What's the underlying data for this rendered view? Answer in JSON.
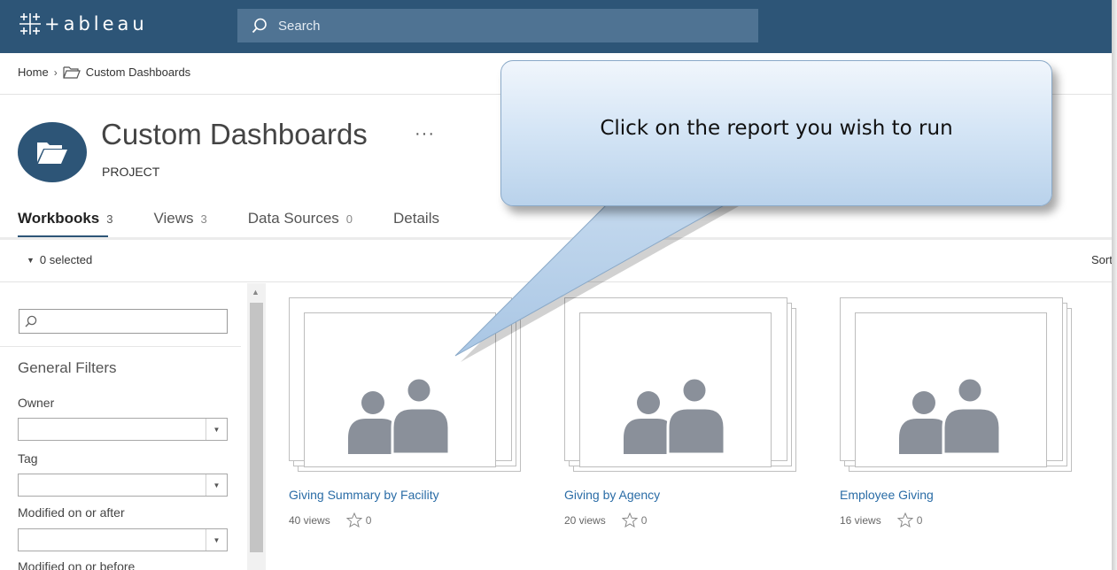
{
  "topbar": {
    "logo_text": "+ableau",
    "search_placeholder": "Search"
  },
  "breadcrumb": {
    "home": "Home",
    "separator": "›",
    "current": "Custom Dashboards"
  },
  "project": {
    "title": "Custom Dashboards",
    "more": "···",
    "type": "PROJECT"
  },
  "tabs": [
    {
      "label": "Workbooks",
      "count": "3",
      "active": true
    },
    {
      "label": "Views",
      "count": "3",
      "active": false
    },
    {
      "label": "Data Sources",
      "count": "0",
      "active": false
    },
    {
      "label": "Details",
      "count": "",
      "active": false
    }
  ],
  "toolbar": {
    "selected": "0 selected",
    "sort": "Sort by"
  },
  "filters": {
    "search_placeholder": "",
    "title": "General Filters",
    "owner_label": "Owner",
    "tag_label": "Tag",
    "modified_after_label": "Modified on or after",
    "modified_before_label": "Modified on or before"
  },
  "workbooks": [
    {
      "title": "Giving Summary by Facility",
      "views": "40 views",
      "favorites": "0"
    },
    {
      "title": "Giving by Agency",
      "views": "20 views",
      "favorites": "0"
    },
    {
      "title": "Employee Giving",
      "views": "16 views",
      "favorites": "0"
    }
  ],
  "callout": {
    "text": "Click on the report you wish to run"
  },
  "colors": {
    "brand": "#2d5577",
    "link": "#2a6ca6",
    "callout": "#c9ddf1"
  }
}
